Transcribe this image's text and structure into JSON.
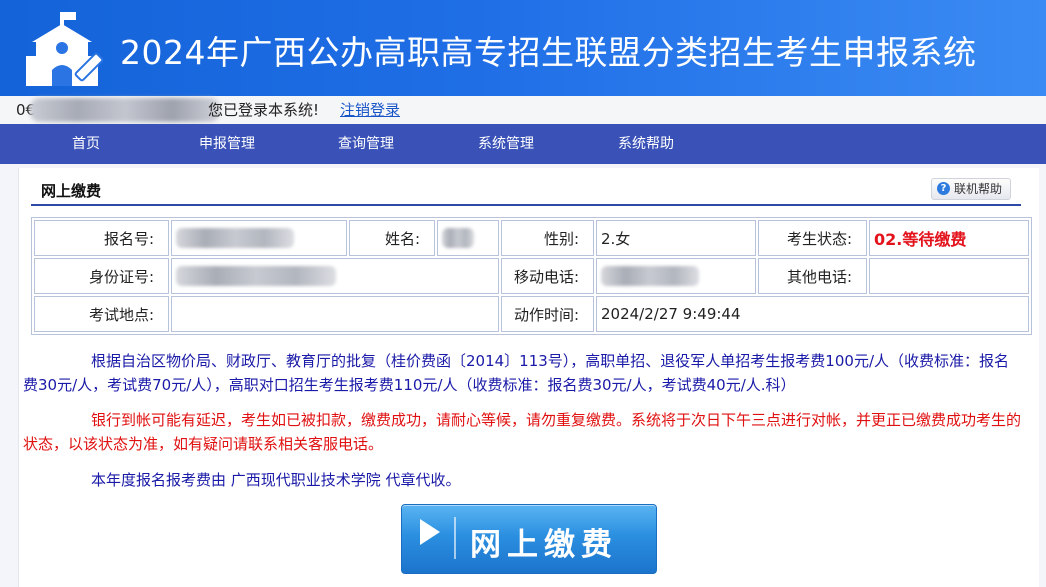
{
  "banner": {
    "title": "2024年广西公办高职高专招生联盟分类招生考生申报系统",
    "logo_icon": "school-edit-icon"
  },
  "userbar": {
    "user_prefix": "0€",
    "message": "您已登录本系统!",
    "logout_link": "注销登录"
  },
  "nav": {
    "items": [
      "首页",
      "申报管理",
      "查询管理",
      "系统管理",
      "系统帮助"
    ]
  },
  "panel": {
    "title": "网上缴费",
    "help_button": "联机帮助",
    "help_icon": "question-circle-icon"
  },
  "info": {
    "reg_no_label": "报名号:",
    "name_label": "姓名:",
    "gender_label": "性别:",
    "gender_value": "2.女",
    "status_label": "考生状态:",
    "status_value": "02.等待缴费",
    "id_label": "身份证号:",
    "mobile_label": "移动电话:",
    "other_phone_label": "其他电话:",
    "exam_site_label": "考试地点:",
    "action_time_label": "动作时间:",
    "action_time_value": "2024/2/27 9:49:44"
  },
  "notices": {
    "p1": "根据自治区物价局、财政厅、教育厅的批复（桂价费函〔2014〕113号），高职单招、退役军人单招考生报考费100元/人（收费标准：报名费30元/人，考试费70元/人），高职对口招生考生报考费110元/人（收费标准：报名费30元/人，考试费40元/人.科）",
    "p2": "银行到帐可能有延迟，考生如已被扣款，缴费成功，请耐心等候，请勿重复缴费。系统将于次日下午三点进行对帐，并更正已缴费成功考生的状态，以该状态为准，如有疑问请联系相关客服电话。",
    "p3": "本年度报名报考费由 广西现代职业技术学院 代章代收。"
  },
  "pay_button": {
    "label": "网上缴费",
    "icon": "play-icon"
  },
  "colors": {
    "banner_blue": "#1f6ee6",
    "nav_blue": "#3a52b8",
    "status_red": "#e3121b",
    "notice_blue": "#1a1aa8",
    "notice_red": "#e01010"
  }
}
